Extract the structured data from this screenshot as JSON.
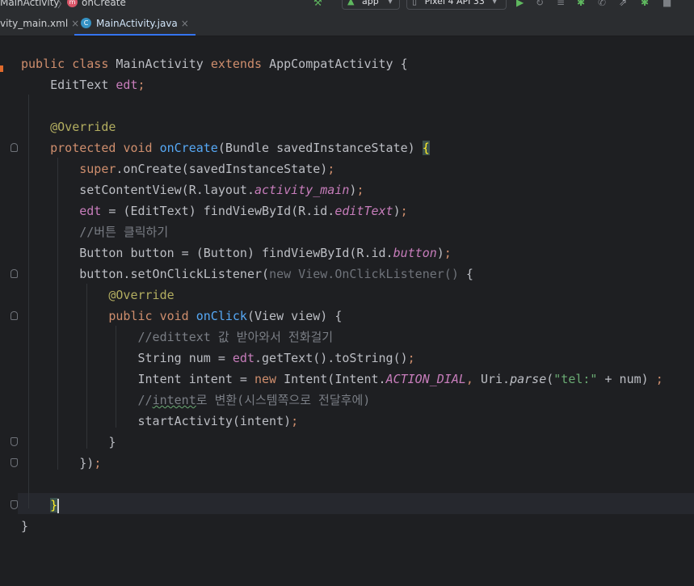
{
  "toolbar": {
    "breadcrumb_class": "MainActivity",
    "breadcrumb_sep": "〉",
    "breadcrumb_method": "onCreate",
    "breadcrumb_method_badge": "m",
    "run_config": "app",
    "device": "Pixel 4 API 33"
  },
  "tabs": [
    {
      "label": "vity_main.xml",
      "close": "×"
    },
    {
      "label": "MainActivity.java",
      "close": "×",
      "badge": "C"
    }
  ],
  "code": {
    "l1": {
      "kw1": "public",
      "kw2": "class",
      "name": "MainActivity",
      "kw3": "extends",
      "super": "AppCompatActivity",
      "brace": "{"
    },
    "l2": {
      "type": "EditText",
      "field": "edt",
      "semi": ";"
    },
    "l4": {
      "ann": "@Override"
    },
    "l5": {
      "kw1": "protected",
      "kw2": "void",
      "fn": "onCreate",
      "params": "(Bundle savedInstanceState)",
      "brace": "{"
    },
    "l6": {
      "kw": "super",
      "rest": ".onCreate(savedInstanceState)",
      "semi": ";"
    },
    "l7": {
      "a": "setContentView(R.layout.",
      "b": "activity_main",
      "c": ")",
      "semi": ";"
    },
    "l8": {
      "field": "edt",
      "a": " = (EditText) findViewById(R.id.",
      "b": "editText",
      "c": ")",
      "semi": ";"
    },
    "l9": {
      "comment": "//버튼 클릭하기"
    },
    "l10": {
      "a": "Button button = (Button) findViewById(R.id.",
      "b": "button",
      "c": ")",
      "semi": ";"
    },
    "l11": {
      "a": "button.setOnClickListener(",
      "b": "new View.OnClickListener()",
      "c": " {"
    },
    "l12": {
      "ann": "@Override"
    },
    "l13": {
      "kw1": "public",
      "kw2": "void",
      "fn": "onClick",
      "params": "(View view) {"
    },
    "l14": {
      "comment": "//edittext 값 받아와서 전화걸기"
    },
    "l15": {
      "a": "String num = ",
      "field": "edt",
      "b": ".getText().toString()",
      "semi": ";"
    },
    "l16": {
      "a": "Intent intent = ",
      "kw": "new",
      "b": " Intent(Intent.",
      "const": "ACTION_DIAL",
      "comma": ", ",
      "c": "Uri.",
      "method": "parse",
      "d": "(",
      "str": "\"tel:\"",
      "e": " + num) ",
      "semi": ";"
    },
    "l17": {
      "c1": "//",
      "c2": "intent",
      "c3": "로 변환(시스템쪽으로 전달후에)"
    },
    "l18": {
      "a": "startActivity(intent)",
      "semi": ";"
    },
    "l19": {
      "brace": "}"
    },
    "l20": {
      "a": "})",
      "semi": ";"
    },
    "l22": {
      "brace": "}"
    },
    "l23": {
      "brace": "}"
    }
  }
}
